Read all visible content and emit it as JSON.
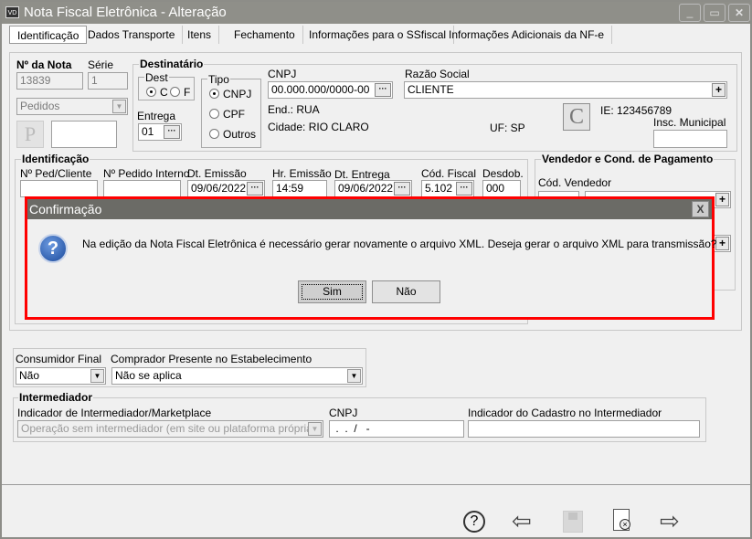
{
  "window": {
    "title": "Nota Fiscal Eletrônica - Alteração",
    "app_badge": "VD"
  },
  "tabs": [
    "Identificação",
    "Dados Transporte",
    "Itens",
    "Fechamento",
    "Informações para o SSfiscal",
    "Informações Adicionais da NF-e"
  ],
  "nota": {
    "numero_label": "Nº da Nota",
    "numero": "13839",
    "serie_label": "Série",
    "serie": "1",
    "tipo_select": "Pedidos",
    "p_button": "P"
  },
  "destinatario": {
    "title": "Destinatário",
    "dest_label": "Dest",
    "dest_c": "C",
    "dest_f": "F",
    "entrega_label": "Entrega",
    "entrega": "01",
    "tipo_label": "Tipo",
    "tipo_options": [
      "CNPJ",
      "CPF",
      "Outros"
    ],
    "cnpj_label": "CNPJ",
    "cnpj": "00.000.000/0000-00",
    "razao_label": "Razão Social",
    "razao": "CLIENTE",
    "endereco": "End.: RUA",
    "cidade": "Cidade: RIO CLARO",
    "uf": "UF: SP",
    "c_button": "C",
    "ie": "IE: 123456789",
    "insc_municipal_label": "Insc. Municipal",
    "insc_municipal": ""
  },
  "identificacao": {
    "title": "Identificação",
    "ped_cliente_label": "Nº Ped/Cliente",
    "pedido_interno_label": "Nº Pedido Interno",
    "dt_emissao_label": "Dt. Emissão",
    "dt_emissao": "09/06/2022",
    "hr_emissao_label": "Hr. Emissão",
    "hr_emissao": "14:59",
    "dt_entrega_label": "Dt. Entrega",
    "dt_entrega": "09/06/2022",
    "cod_fiscal_label": "Cód. Fiscal",
    "cod_fiscal": "5.102",
    "desdob_label": "Desdob.",
    "desdob": "000"
  },
  "vendedor": {
    "title": "Vendedor e Cond. de Pagamento",
    "cod_vendedor_label": "Cód. Vendedor"
  },
  "consumidor": {
    "consumidor_final_label": "Consumidor Final",
    "consumidor_final": "Não",
    "comprador_label": "Comprador Presente no Estabelecimento",
    "comprador": "Não se aplica"
  },
  "intermediador": {
    "title": "Intermediador",
    "indicador_label": "Indicador de Intermediador/Marketplace",
    "indicador": "Operação sem intermediador (em site ou plataforma própria)",
    "cnpj_label": "CNPJ",
    "cnpj": " .  .  /   -",
    "cadastro_label": "Indicador do Cadastro no Intermediador",
    "cadastro": ""
  },
  "dialog": {
    "title": "Confirmação",
    "message": "Na edição da Nota Fiscal Eletrônica é necessário gerar novamente o arquivo XML. Deseja gerar o arquivo XML para transmissão?",
    "yes": "Sim",
    "no": "Não",
    "highlight_color": "#ff0000"
  },
  "toolbar": {
    "help": "?",
    "back": "⇦",
    "save": "save-icon",
    "cancel": "cancel-doc-icon",
    "forward": "⇨"
  }
}
